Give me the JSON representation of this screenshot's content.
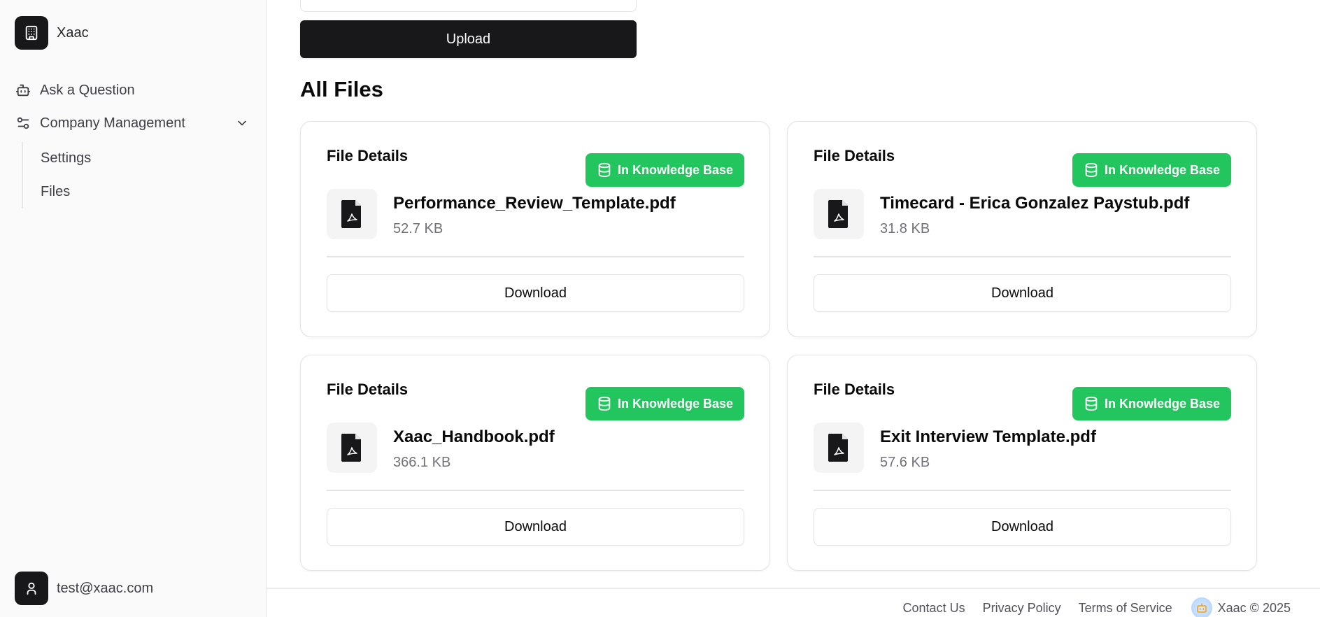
{
  "sidebar": {
    "brand_name": "Xaac",
    "nav": {
      "ask": "Ask a Question",
      "company": "Company Management",
      "settings": "Settings",
      "files": "Files"
    },
    "user_email": "test@xaac.com"
  },
  "main": {
    "upload_label": "Upload",
    "section_title": "All Files",
    "files": [
      {
        "card_title": "File Details",
        "badge": "In Knowledge Base",
        "name": "Performance_Review_Template.pdf",
        "size": "52.7 KB",
        "download_label": "Download"
      },
      {
        "card_title": "File Details",
        "badge": "In Knowledge Base",
        "name": "Timecard - Erica Gonzalez Paystub.pdf",
        "size": "31.8 KB",
        "download_label": "Download"
      },
      {
        "card_title": "File Details",
        "badge": "In Knowledge Base",
        "name": "Xaac_Handbook.pdf",
        "size": "366.1 KB",
        "download_label": "Download"
      },
      {
        "card_title": "File Details",
        "badge": "In Knowledge Base",
        "name": "Exit Interview Template.pdf",
        "size": "57.6 KB",
        "download_label": "Download"
      }
    ]
  },
  "footer": {
    "contact": "Contact Us",
    "privacy": "Privacy Policy",
    "terms": "Terms of Service",
    "copyright": "Xaac © 2025"
  },
  "colors": {
    "accent_dark": "#18181b",
    "badge_green": "#22c55e",
    "muted_text": "#71717a"
  }
}
